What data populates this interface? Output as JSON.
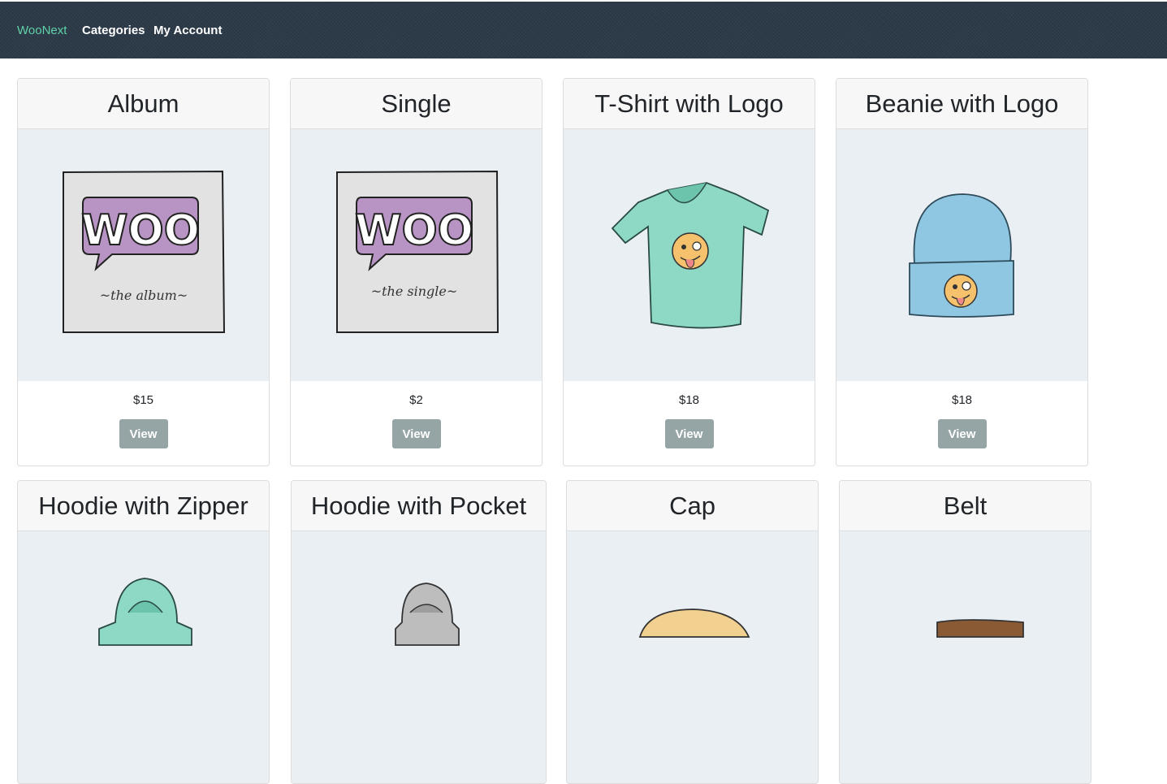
{
  "nav": {
    "brand": "WooNext",
    "links": [
      "Categories",
      "My Account"
    ]
  },
  "colors": {
    "navbar": "#2c3947",
    "brand": "#5fd2a8",
    "card_header": "#f7f7f7",
    "image_bg": "#eaeff4",
    "view_button": "#95a5a6"
  },
  "products": [
    {
      "name": "Album",
      "price": "$15",
      "button": "View",
      "image_icon": "woo-album-cover"
    },
    {
      "name": "Single",
      "price": "$2",
      "button": "View",
      "image_icon": "woo-single-cover"
    },
    {
      "name": "T-Shirt with Logo",
      "price": "$18",
      "button": "View",
      "image_icon": "tshirt-with-logo"
    },
    {
      "name": "Beanie with Logo",
      "price": "$18",
      "button": "View",
      "image_icon": "beanie-with-logo"
    },
    {
      "name": "Hoodie with Zipper",
      "image_icon": "green-hoodie"
    },
    {
      "name": "Hoodie with Pocket",
      "image_icon": "grey-hoodie"
    },
    {
      "name": "Cap",
      "image_icon": "cap"
    },
    {
      "name": "Belt",
      "image_icon": "belt"
    }
  ]
}
